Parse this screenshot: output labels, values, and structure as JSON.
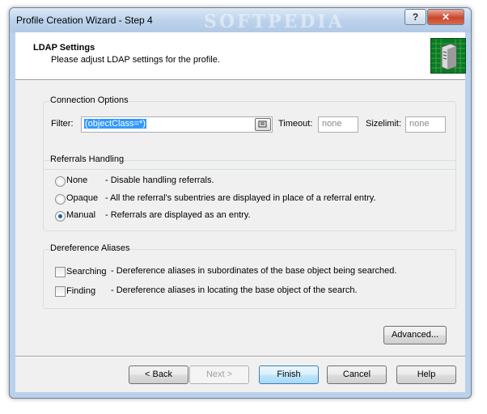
{
  "window": {
    "title": "Profile Creation Wizard - Step 4",
    "title_decoration": "SOFTPEDIA",
    "help_label": "?",
    "close_label": "✕"
  },
  "header": {
    "title": "LDAP Settings",
    "subtitle": "Please adjust LDAP settings for the profile.",
    "icon": "server-icon"
  },
  "connection": {
    "group_label": "Connection Options",
    "filter_label": "Filter:",
    "filter_value": "(objectClass=*)",
    "timeout_label": "Timeout:",
    "timeout_placeholder": "none",
    "sizelimit_label": "Sizelimit:",
    "sizelimit_placeholder": "none"
  },
  "referrals": {
    "group_label": "Referrals Handling",
    "options": [
      {
        "label": "None",
        "desc": "- Disable handling referrals.",
        "checked": false
      },
      {
        "label": "Opaque",
        "desc": "- All the referral's subentries are displayed in place of a referral entry.",
        "checked": false
      },
      {
        "label": "Manual",
        "desc": "- Referrals are displayed as an entry.",
        "checked": true
      }
    ]
  },
  "dereference": {
    "group_label": "Dereference Aliases",
    "options": [
      {
        "label": "Searching",
        "desc": "- Dereference aliases in subordinates of the base object being searched.",
        "checked": false
      },
      {
        "label": "Finding",
        "desc": "- Dereference aliases in locating the base object of the search.",
        "checked": false
      }
    ]
  },
  "advanced_label": "Advanced...",
  "footer": {
    "back": "< Back",
    "next": "Next >",
    "finish": "Finish",
    "cancel": "Cancel",
    "help": "Help"
  }
}
